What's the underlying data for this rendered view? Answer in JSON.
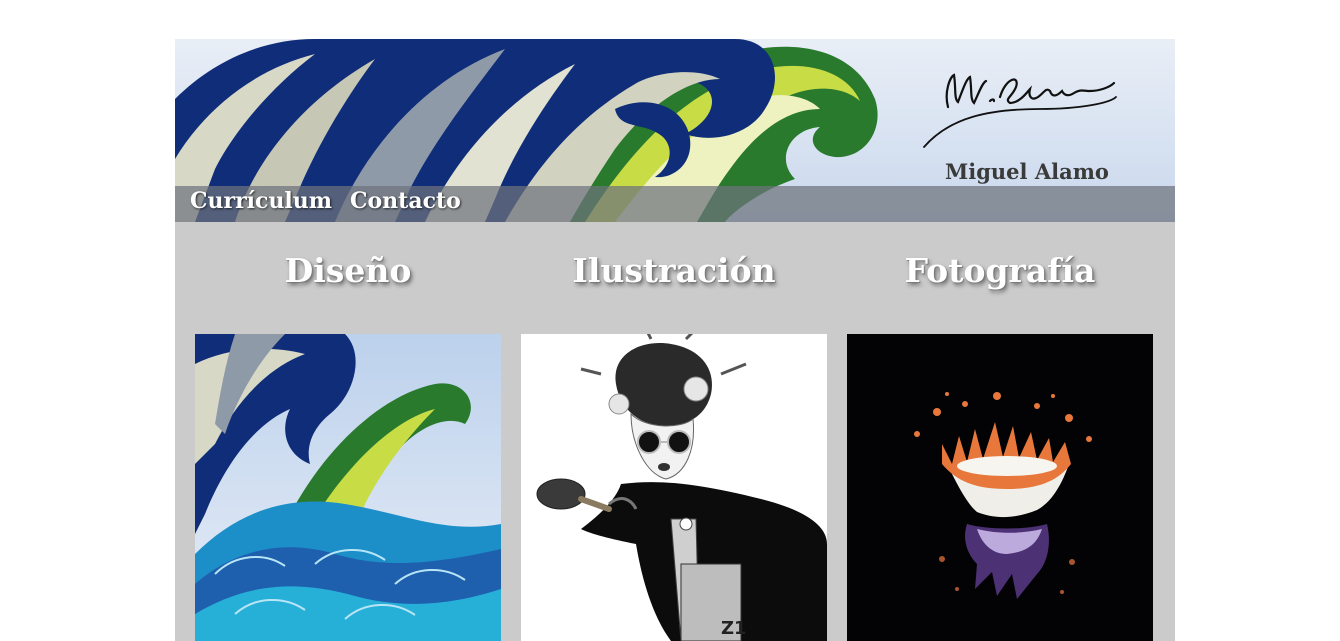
{
  "header": {
    "nav": [
      "Currículum",
      "Contacto"
    ],
    "site_name": "Miguel Alamo",
    "signature_text": "M. Alamo"
  },
  "categories": [
    {
      "title": "Diseño",
      "image": "wave-illustration"
    },
    {
      "title": "Ilustración",
      "image": "geisha-ping-pong-illustration"
    },
    {
      "title": "Fotografía",
      "image": "milk-splash-crown-photo"
    }
  ],
  "colors": {
    "page_bg": "#ffffff",
    "content_bg": "#cbcbcb",
    "navbar_bg": "#6e737d",
    "wave_navy": "#0f2d78",
    "wave_green": "#2a7a2e",
    "wave_lime": "#c8dc46",
    "wave_cyan": "#1fa7d8"
  }
}
